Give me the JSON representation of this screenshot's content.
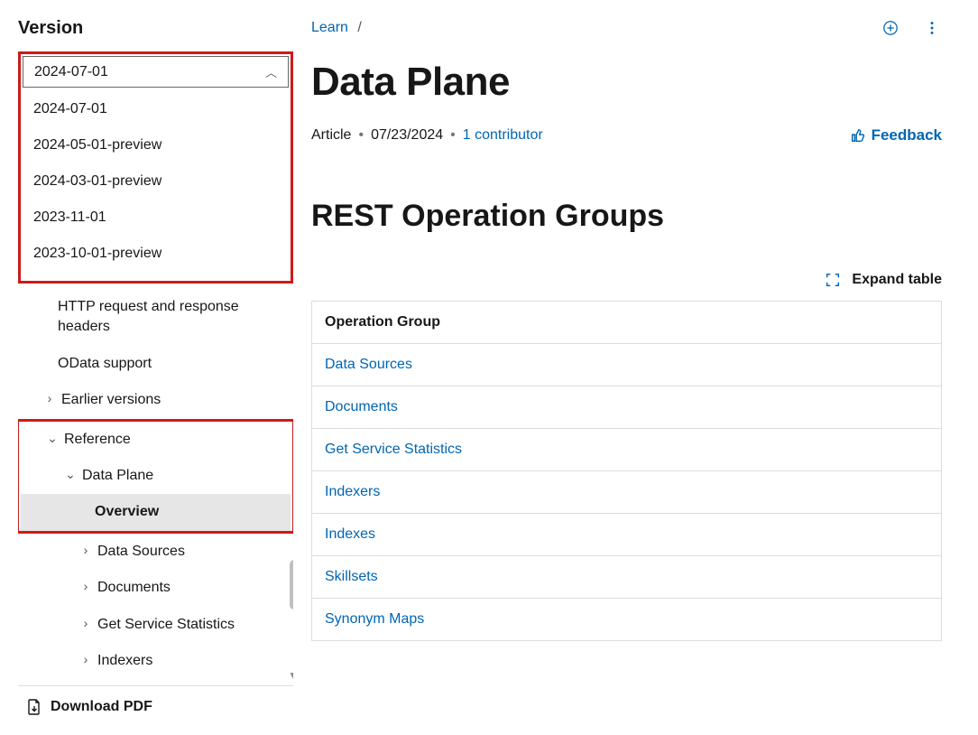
{
  "sidebar": {
    "version_label": "Version",
    "selected_version": "2024-07-01",
    "version_options": [
      "2024-07-01",
      "2024-05-01-preview",
      "2024-03-01-preview",
      "2023-11-01",
      "2023-10-01-preview"
    ],
    "nav": {
      "http_headers": "HTTP request and response headers",
      "odata": "OData support",
      "earlier": "Earlier versions",
      "reference": "Reference",
      "data_plane": "Data Plane",
      "overview": "Overview",
      "items": [
        "Data Sources",
        "Documents",
        "Get Service Statistics",
        "Indexers"
      ]
    },
    "download": "Download PDF"
  },
  "main": {
    "breadcrumb": {
      "learn": "Learn",
      "sep": "/"
    },
    "title": "Data Plane",
    "meta": {
      "type": "Article",
      "date": "07/23/2024",
      "contributors": "1 contributor"
    },
    "feedback": "Feedback",
    "section_title": "REST Operation Groups",
    "expand_label": "Expand table",
    "table": {
      "header": "Operation Group",
      "rows": [
        "Data Sources",
        "Documents",
        "Get Service Statistics",
        "Indexers",
        "Indexes",
        "Skillsets",
        "Synonym Maps"
      ]
    }
  }
}
